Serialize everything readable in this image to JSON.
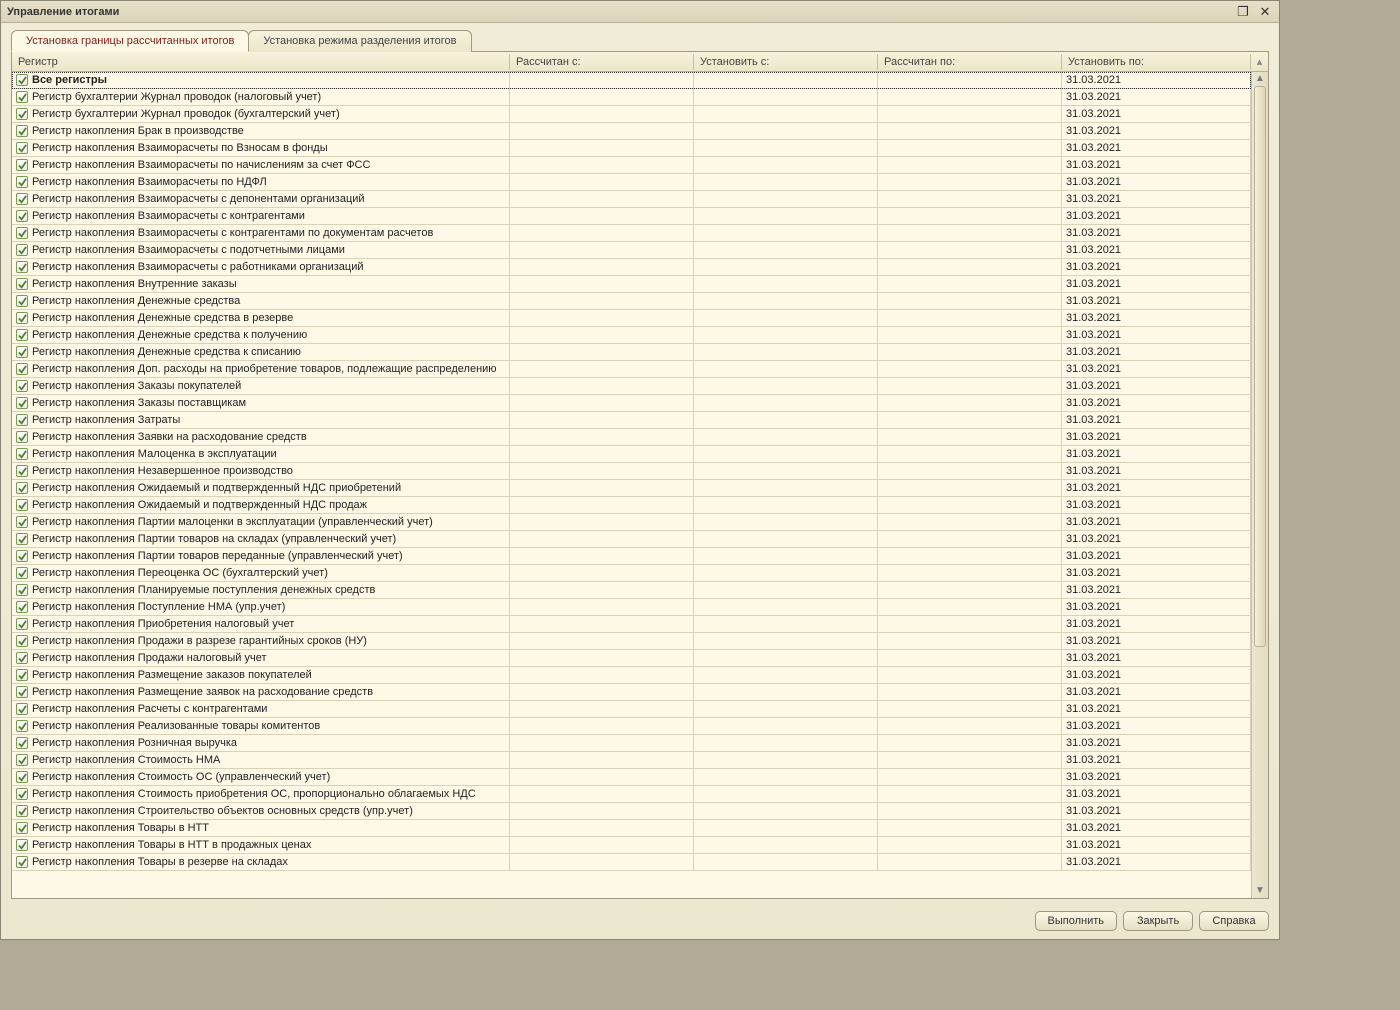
{
  "window": {
    "title": "Управление итогами"
  },
  "tabs": {
    "active": "Установка границы рассчитанных итогов",
    "inactive": "Установка режима разделения итогов"
  },
  "columns": {
    "register": "Регистр",
    "calc_from": "Рассчитан с:",
    "set_from": "Установить с:",
    "calc_to": "Рассчитан по:",
    "set_to": "Установить по:"
  },
  "set_to_value": "31.03.2021",
  "rows": [
    {
      "label": "Все регистры",
      "bold": true,
      "selected": true
    },
    {
      "label": "Регистр бухгалтерии Журнал проводок (налоговый учет)"
    },
    {
      "label": "Регистр бухгалтерии Журнал проводок (бухгалтерский учет)"
    },
    {
      "label": "Регистр накопления Брак в производстве"
    },
    {
      "label": "Регистр накопления Взаиморасчеты по Взносам в фонды"
    },
    {
      "label": "Регистр накопления Взаиморасчеты по начислениям за счет ФСС"
    },
    {
      "label": "Регистр накопления Взаиморасчеты по НДФЛ"
    },
    {
      "label": "Регистр накопления Взаиморасчеты с депонентами организаций"
    },
    {
      "label": "Регистр накопления Взаиморасчеты с контрагентами"
    },
    {
      "label": "Регистр накопления Взаиморасчеты с контрагентами по документам расчетов"
    },
    {
      "label": "Регистр накопления Взаиморасчеты с подотчетными лицами"
    },
    {
      "label": "Регистр накопления Взаиморасчеты с работниками организаций"
    },
    {
      "label": "Регистр накопления Внутренние заказы"
    },
    {
      "label": "Регистр накопления Денежные средства"
    },
    {
      "label": "Регистр накопления Денежные средства в резерве"
    },
    {
      "label": "Регистр накопления Денежные средства к получению"
    },
    {
      "label": "Регистр накопления Денежные средства к списанию"
    },
    {
      "label": "Регистр накопления Доп. расходы на приобретение товаров, подлежащие распределению"
    },
    {
      "label": "Регистр накопления Заказы покупателей"
    },
    {
      "label": "Регистр накопления Заказы поставщикам"
    },
    {
      "label": "Регистр накопления Затраты"
    },
    {
      "label": "Регистр накопления Заявки на расходование средств"
    },
    {
      "label": "Регистр накопления Малоценка в эксплуатации"
    },
    {
      "label": "Регистр накопления Незавершенное производство"
    },
    {
      "label": "Регистр накопления Ожидаемый и подтвержденный НДС приобретений"
    },
    {
      "label": "Регистр накопления Ожидаемый и подтвержденный НДС продаж"
    },
    {
      "label": "Регистр накопления Партии малоценки в эксплуатации (управленческий учет)"
    },
    {
      "label": "Регистр накопления Партии товаров на складах (управленческий учет)"
    },
    {
      "label": "Регистр накопления Партии товаров переданные (управленческий учет)"
    },
    {
      "label": "Регистр накопления Переоценка ОС (бухгалтерский учет)"
    },
    {
      "label": "Регистр накопления Планируемые поступления денежных средств"
    },
    {
      "label": "Регистр накопления Поступление НМА (упр.учет)"
    },
    {
      "label": "Регистр накопления Приобретения налоговый учет"
    },
    {
      "label": "Регистр накопления Продажи в разрезе гарантийных сроков (НУ)"
    },
    {
      "label": "Регистр накопления Продажи налоговый учет"
    },
    {
      "label": "Регистр накопления Размещение заказов покупателей"
    },
    {
      "label": "Регистр накопления Размещение заявок на расходование средств"
    },
    {
      "label": "Регистр накопления Расчеты с контрагентами"
    },
    {
      "label": "Регистр накопления Реализованные товары комитентов"
    },
    {
      "label": "Регистр накопления Розничная выручка"
    },
    {
      "label": "Регистр накопления Стоимость НМА"
    },
    {
      "label": "Регистр накопления Стоимость ОС (управленческий учет)"
    },
    {
      "label": "Регистр накопления Стоимость приобретения ОС, пропорционально облагаемых НДС"
    },
    {
      "label": "Регистр накопления Строительство объектов основных средств (упр.учет)"
    },
    {
      "label": "Регистр накопления Товары в НТТ"
    },
    {
      "label": "Регистр накопления Товары в НТТ в продажных ценах"
    },
    {
      "label": "Регистр накопления Товары в резерве на складах"
    }
  ],
  "buttons": {
    "execute": "Выполнить",
    "close": "Закрыть",
    "help": "Справка"
  }
}
